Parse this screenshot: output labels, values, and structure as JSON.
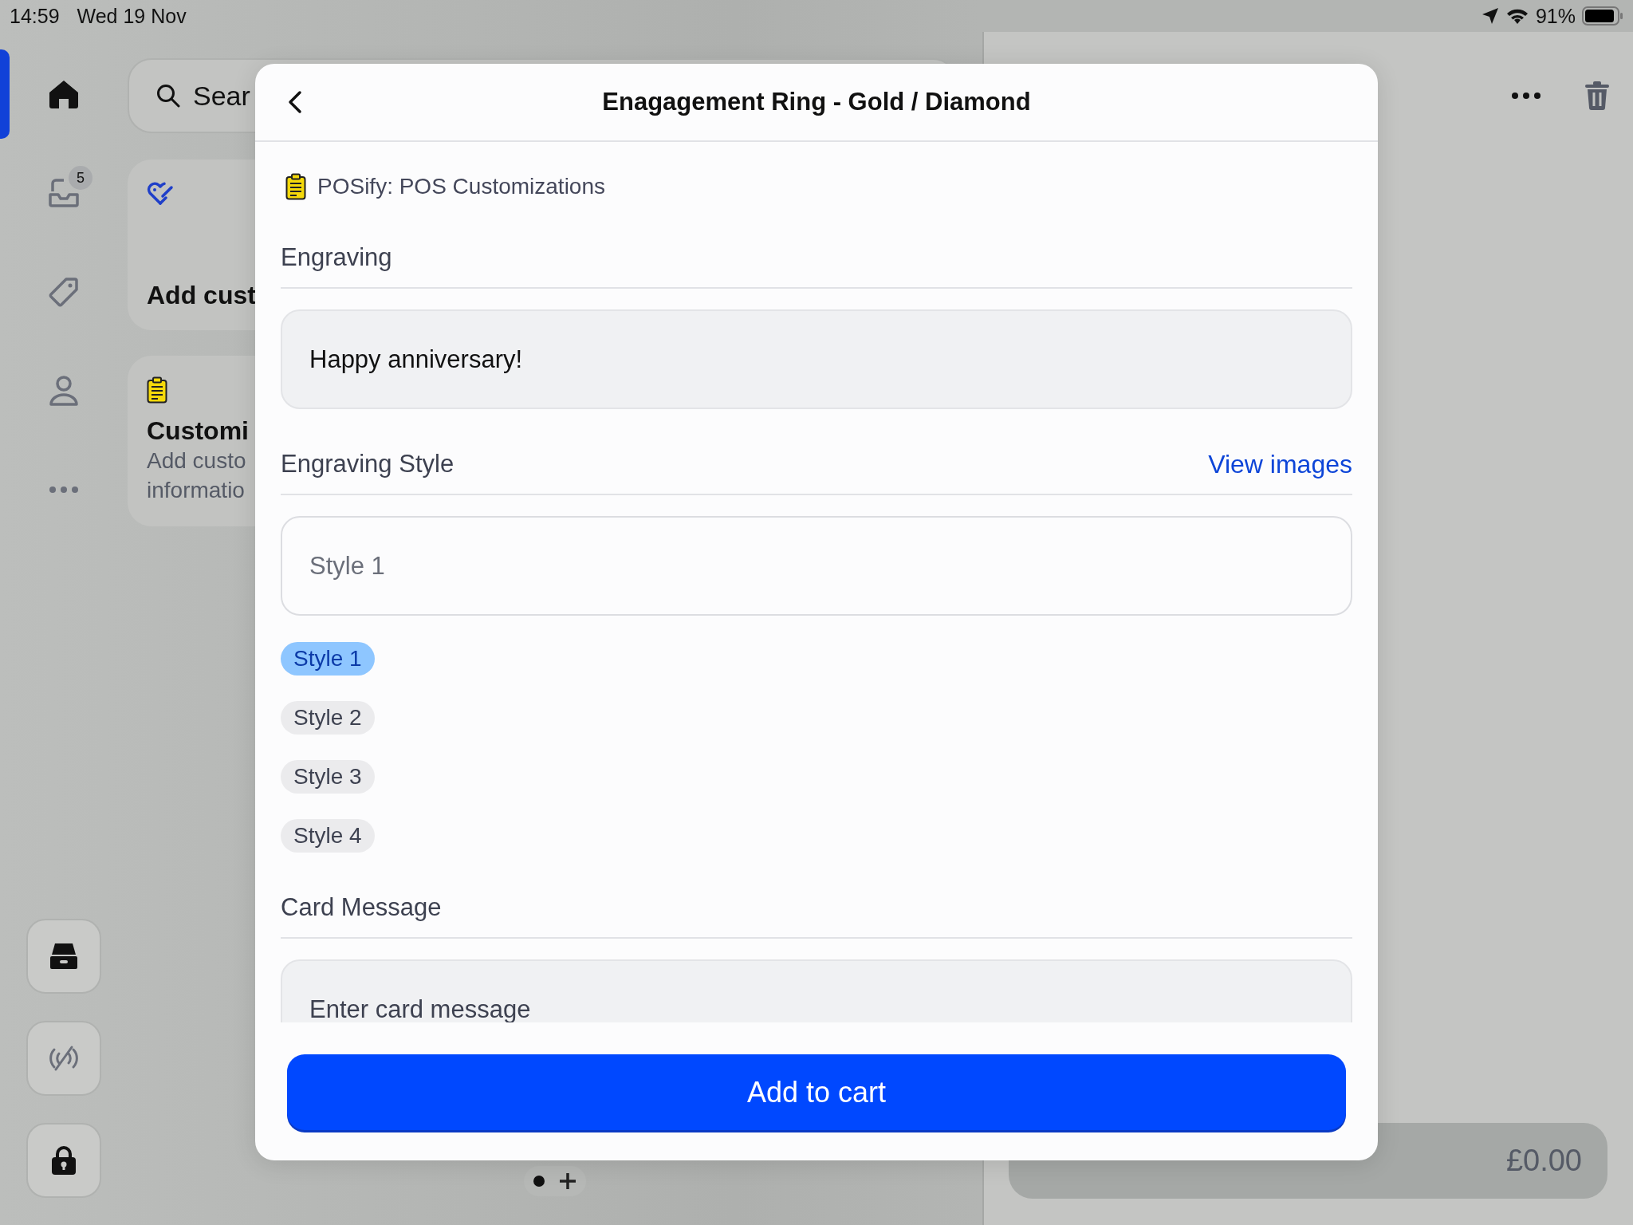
{
  "status_bar": {
    "time": "14:59",
    "date": "Wed 19 Nov",
    "battery": "91%"
  },
  "rail": {
    "items": [
      {
        "kind": "home",
        "selected": true
      },
      {
        "kind": "inbox",
        "badge": "5",
        "selected": false
      },
      {
        "kind": "tag",
        "selected": false
      },
      {
        "kind": "person",
        "selected": false
      },
      {
        "kind": "more",
        "selected": false
      }
    ],
    "buttons": [
      {
        "kind": "register"
      },
      {
        "kind": "contactless"
      },
      {
        "kind": "lock"
      }
    ]
  },
  "search": {
    "placeholder": "Sear"
  },
  "tiles": [
    {
      "kind": "customer",
      "title": "Add cust"
    },
    {
      "kind": "app",
      "title": "Customi",
      "lines": [
        "Add custo",
        "informatio"
      ]
    }
  ],
  "cart": {
    "total": "£0.00"
  },
  "modal": {
    "title": "Enagagement Ring - Gold / Diamond",
    "source": "POSify: POS Customizations",
    "sections": [
      {
        "kind": "text",
        "label": "Engraving",
        "value": "Happy anniversary!"
      },
      {
        "kind": "select",
        "label": "Engraving Style",
        "link": "View images",
        "placeholder": "Style 1",
        "options": [
          {
            "label": "Style 1",
            "selected": true
          },
          {
            "label": "Style 2",
            "selected": false
          },
          {
            "label": "Style 3",
            "selected": false
          },
          {
            "label": "Style 4",
            "selected": false
          }
        ]
      },
      {
        "kind": "text",
        "label": "Card Message",
        "placeholder": "Enter card message"
      }
    ],
    "button": "Add to cart"
  }
}
